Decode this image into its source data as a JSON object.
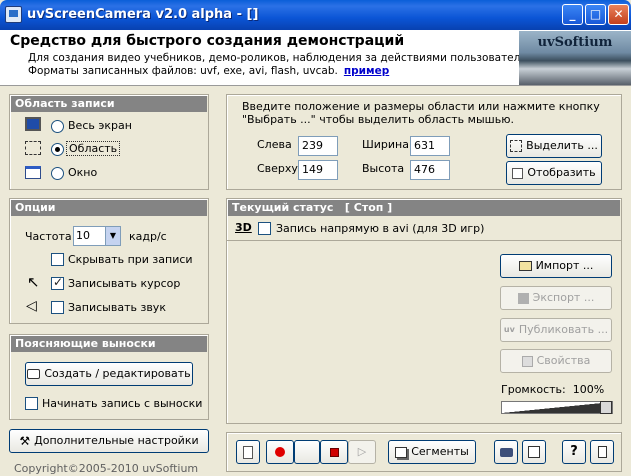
{
  "window": {
    "title": "uvScreenCamera v2.0 alpha - []",
    "minimize": "_",
    "maximize": "□",
    "close": "✕"
  },
  "header": {
    "title": "Средство для быстрого создания демонстраций",
    "line1": "Для создания видео учебников, демо-роликов, наблюдения за действиями пользователя",
    "line2": "Форматы записанных файлов: uvf, exe, avi, flash, uvcab.",
    "link": "пример",
    "logo": "uvSoftium"
  },
  "record_area": {
    "title": "Область записи",
    "options": [
      "Весь экран",
      "Область",
      "Окно"
    ],
    "selected": "Область"
  },
  "region": {
    "hint1": "Введите положение и размеры области или нажмите кнопку",
    "hint2": "\"Выбрать ...\" чтобы выделить область мышью.",
    "left_label": "Слева",
    "left_value": "239",
    "top_label": "Сверху",
    "top_value": "149",
    "width_label": "Ширина",
    "width_value": "631",
    "height_label": "Высота",
    "height_value": "476",
    "select_button": "Выделить ...",
    "show_button": "Отобразить"
  },
  "options": {
    "title": "Опции",
    "fps_label": "Частота",
    "fps_value": "10",
    "fps_unit": "кадр/с",
    "hide_label": "Скрывать при записи",
    "hide_checked": false,
    "cursor_label": "Записывать курсор",
    "cursor_checked": true,
    "sound_label": "Записывать звук",
    "sound_checked": false
  },
  "callouts": {
    "title": "Поясняющие выноски",
    "edit_button": "Создать / редактировать",
    "start_label": "Начинать запись с выноски",
    "start_checked": false
  },
  "extra_settings_button": "Дополнительные настройки",
  "copyright": "Copyright©2005-2010 uvSoftium",
  "status": {
    "title": "Текущий статус",
    "state": "[ Стоп ]",
    "avi_badge": "3D",
    "avi_label": "Запись напрямую в avi (для 3D игр)",
    "avi_checked": false,
    "import_button": "Импорт ...",
    "export_button": "Экспорт ...",
    "publish_button": "Публиковать ...",
    "publish_prefix": "uv",
    "properties_button": "Свойства",
    "volume_label": "Громкость:",
    "volume_value": "100%",
    "volume_level": 1.0
  },
  "toolbar": {
    "segments_button": "Сегменты",
    "help_button": "?"
  }
}
